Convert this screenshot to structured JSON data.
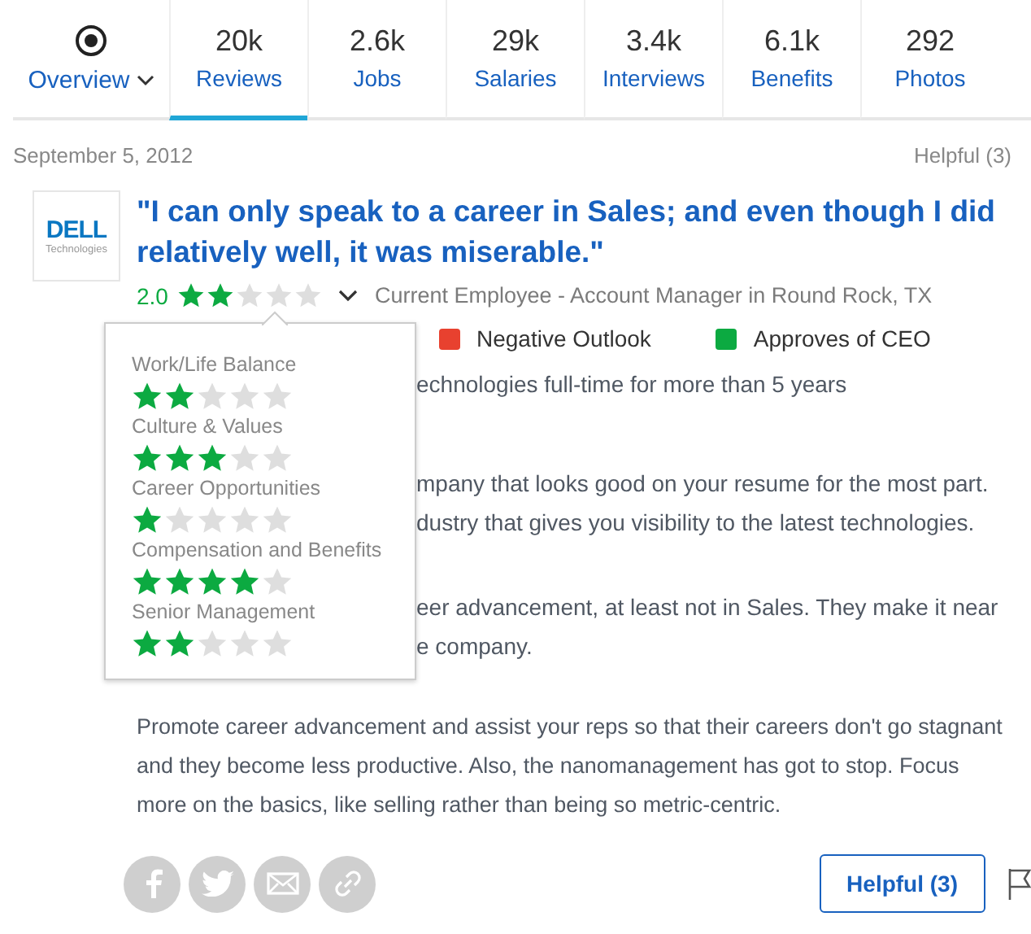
{
  "nav": {
    "overview": {
      "label": "Overview"
    },
    "tabs": [
      {
        "count": "20k",
        "label": "Reviews",
        "selected": true
      },
      {
        "count": "2.6k",
        "label": "Jobs",
        "selected": false
      },
      {
        "count": "29k",
        "label": "Salaries",
        "selected": false
      },
      {
        "count": "3.4k",
        "label": "Interviews",
        "selected": false
      },
      {
        "count": "6.1k",
        "label": "Benefits",
        "selected": false
      },
      {
        "count": "292",
        "label": "Photos",
        "selected": false
      }
    ]
  },
  "review": {
    "date": "September 5, 2012",
    "helpful_count": "Helpful (3)",
    "logo": {
      "wordmark": "DELL",
      "tagline": "Technologies"
    },
    "title": "\"I can only speak to a career in Sales; and even though I did relatively well, it was miserable.\"",
    "rating": "2.0",
    "stars": 2,
    "author": "Current Employee - Account Manager in Round Rock, TX",
    "subratings": [
      {
        "label": "Work/Life Balance",
        "stars": 2
      },
      {
        "label": "Culture & Values",
        "stars": 3
      },
      {
        "label": "Career Opportunities",
        "stars": 1
      },
      {
        "label": "Compensation and Benefits",
        "stars": 4
      },
      {
        "label": "Senior Management",
        "stars": 2
      }
    ],
    "outlook": [
      {
        "label": "Negative Outlook",
        "color": "#e8412f"
      },
      {
        "label": "Approves of CEO",
        "color": "#0caa41"
      }
    ],
    "employment": "echnologies full-time for more than 5 years",
    "pros": [
      "mpany that looks good on your resume for the most part.",
      "dustry that gives you visibility to the latest technologies."
    ],
    "cons": [
      "eer advancement, at least not in Sales. They make it near",
      "e company."
    ],
    "advice": "Promote career advancement and assist your reps so that their careers don't go stagnant and they become less productive. Also, the nanomanagement has got to stop. Focus more on the basics, like selling rather than being so metric-centric.",
    "helpful_button": "Helpful (3)"
  }
}
